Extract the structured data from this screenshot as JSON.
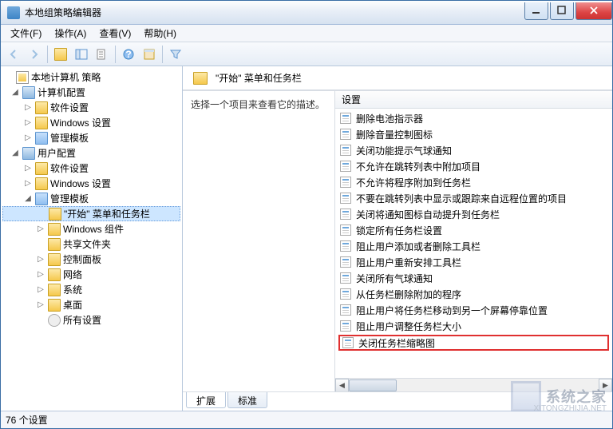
{
  "title": "本地组策略编辑器",
  "menu": {
    "file": "文件(F)",
    "action": "操作(A)",
    "view": "查看(V)",
    "help": "帮助(H)"
  },
  "tree": {
    "root": "本地计算机 策略",
    "computer": "计算机配置",
    "c_software": "软件设置",
    "c_windows": "Windows 设置",
    "c_admin": "管理模板",
    "user": "用户配置",
    "u_software": "软件设置",
    "u_windows": "Windows 设置",
    "u_admin": "管理模板",
    "start_taskbar": "\"开始\" 菜单和任务栏",
    "win_comp": "Windows 组件",
    "shared": "共享文件夹",
    "ctrlpanel": "控制面板",
    "network": "网络",
    "system": "系统",
    "desktop": "桌面",
    "allsettings": "所有设置"
  },
  "header_title": "\"开始\" 菜单和任务栏",
  "desc_text": "选择一个项目来查看它的描述。",
  "list_header": "设置",
  "settings": {
    "i0": "删除电池指示器",
    "i1": "删除音量控制图标",
    "i2": "关闭功能提示气球通知",
    "i3": "不允许在跳转列表中附加项目",
    "i4": "不允许将程序附加到任务栏",
    "i5": "不要在跳转列表中显示或跟踪来自远程位置的项目",
    "i6": "关闭将通知图标自动提升到任务栏",
    "i7": "锁定所有任务栏设置",
    "i8": "阻止用户添加或者删除工具栏",
    "i9": "阻止用户重新安排工具栏",
    "i10": "关闭所有气球通知",
    "i11": "从任务栏删除附加的程序",
    "i12": "阻止用户将任务栏移动到另一个屏幕停靠位置",
    "i13": "阻止用户调整任务栏大小",
    "i14": "关闭任务栏缩略图"
  },
  "tabs": {
    "extended": "扩展",
    "standard": "标准"
  },
  "status": "76 个设置",
  "watermark": {
    "text": "系统之家",
    "url": "XITONGZHIJIA.NET"
  }
}
